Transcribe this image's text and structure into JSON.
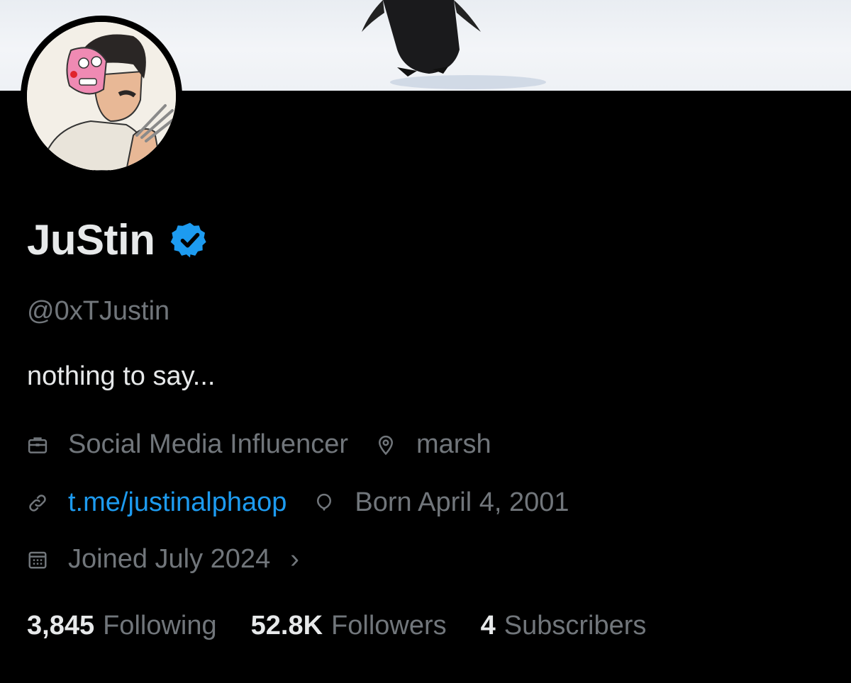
{
  "profile": {
    "display_name": "JuStin",
    "handle": "@0xTJustin",
    "bio": "nothing to say...",
    "verified_icon": "verified-badge-icon",
    "accent_color": "#1d9bf0"
  },
  "meta": {
    "category": "Social Media Influencer",
    "location": "marsh",
    "website": "t.me/justinalphaop",
    "birthday": "Born April 4, 2001",
    "joined": "Joined July 2024"
  },
  "stats": {
    "following_count": "3,845",
    "following_label": "Following",
    "followers_count": "52.8K",
    "followers_label": "Followers",
    "subscribers_count": "4",
    "subscribers_label": "Subscribers"
  }
}
